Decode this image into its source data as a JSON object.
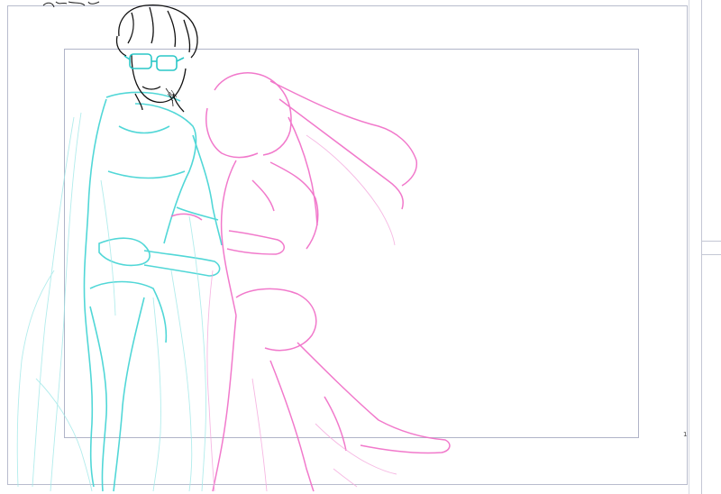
{
  "canvas": {
    "page_number": "1",
    "layers": [
      "cyan-sketch",
      "pink-sketch",
      "black-lineart"
    ]
  },
  "colors": {
    "cyan_sketch": "#3fd3d3",
    "pink_sketch": "#f06bc6",
    "lineart": "#111111",
    "frame": "#b0b4c8"
  },
  "icons": {
    "scrollbar": "scrollbar-handle"
  }
}
